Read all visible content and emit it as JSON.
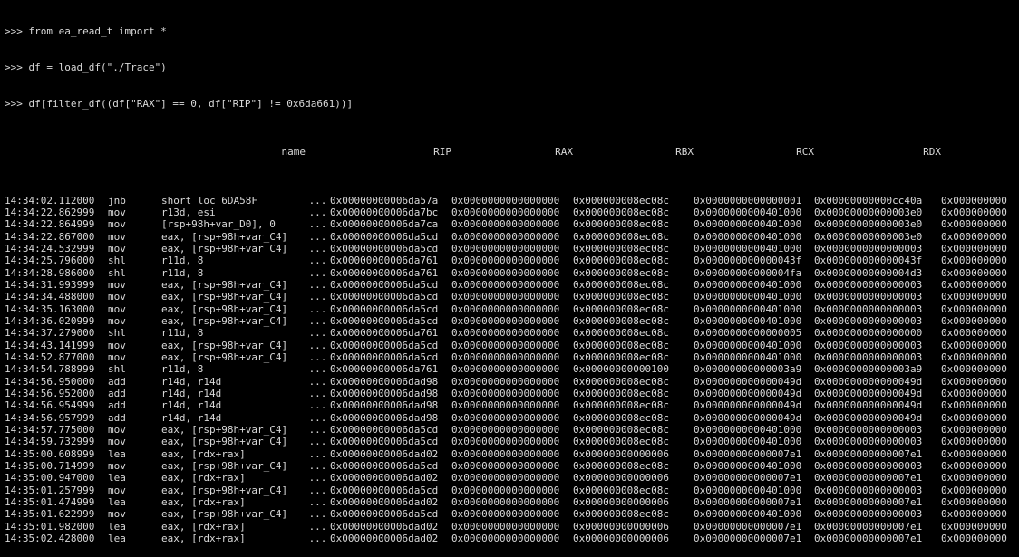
{
  "console": {
    "lines": [
      ">>> from ea_read_t import *",
      ">>> df = load_df(\"./Trace\")",
      ">>> df[filter_df((df[\"RAX\"] == 0, df[\"RIP\"] != 0x6da661))]"
    ]
  },
  "table": {
    "headers": {
      "name": "name",
      "rip": "RIP",
      "rax": "RAX",
      "rbx": "RBX",
      "rcx": "RCX",
      "rdx": "RDX"
    },
    "rows": [
      {
        "ts": "14:34:02.112000",
        "mn": "jnb",
        "op": "short loc_6DA58F",
        "el": "...",
        "rip": "0x00000000006da57a",
        "rax": "0x0000000000000000",
        "rbx": "0x000000008ec08c",
        "rcx": "0x0000000000000001",
        "rdx": "0x00000000000cc40a",
        "rest": "0x000000000"
      },
      {
        "ts": "14:34:22.862999",
        "mn": "mov",
        "op": "r13d, esi",
        "el": "...",
        "rip": "0x00000000006da7bc",
        "rax": "0x0000000000000000",
        "rbx": "0x000000008ec08c",
        "rcx": "0x0000000000401000",
        "rdx": "0x00000000000003e0",
        "rest": "0x000000000"
      },
      {
        "ts": "14:34:22.864999",
        "mn": "mov",
        "op": "[rsp+98h+var_D0], 0",
        "el": "...",
        "rip": "0x00000000006da7ca",
        "rax": "0x0000000000000000",
        "rbx": "0x000000008ec08c",
        "rcx": "0x0000000000401000",
        "rdx": "0x00000000000003e0",
        "rest": "0x000000000"
      },
      {
        "ts": "14:34:22.867000",
        "mn": "mov",
        "op": "eax, [rsp+98h+var_C4]",
        "el": "...",
        "rip": "0x00000000006da5cd",
        "rax": "0x0000000000000000",
        "rbx": "0x000000008ec08c",
        "rcx": "0x0000000000401000",
        "rdx": "0x00000000000003e0",
        "rest": "0x000000000"
      },
      {
        "ts": "14:34:24.532999",
        "mn": "mov",
        "op": "eax, [rsp+98h+var_C4]",
        "el": "...",
        "rip": "0x00000000006da5cd",
        "rax": "0x0000000000000000",
        "rbx": "0x000000008ec08c",
        "rcx": "0x0000000000401000",
        "rdx": "0x0000000000000003",
        "rest": "0x000000000"
      },
      {
        "ts": "14:34:25.796000",
        "mn": "shl",
        "op": "r11d, 8",
        "el": "...",
        "rip": "0x00000000006da761",
        "rbx": "0x000000008ec08c",
        "rax": "0x0000000000000000",
        "rcx": "0x000000000000043f",
        "rdx": "0x000000000000043f",
        "rest": "0x000000000"
      },
      {
        "ts": "14:34:28.986000",
        "mn": "shl",
        "op": "r11d, 8",
        "el": "...",
        "rip": "0x00000000006da761",
        "rax": "0x0000000000000000",
        "rbx": "0x000000008ec08c",
        "rcx": "0x00000000000004fa",
        "rdx": "0x00000000000004d3",
        "rest": "0x000000000"
      },
      {
        "ts": "14:34:31.993999",
        "mn": "mov",
        "op": "eax, [rsp+98h+var_C4]",
        "el": "...",
        "rip": "0x00000000006da5cd",
        "rax": "0x0000000000000000",
        "rbx": "0x000000008ec08c",
        "rcx": "0x0000000000401000",
        "rdx": "0x0000000000000003",
        "rest": "0x000000000"
      },
      {
        "ts": "14:34:34.488000",
        "mn": "mov",
        "op": "eax, [rsp+98h+var_C4]",
        "el": "...",
        "rip": "0x00000000006da5cd",
        "rax": "0x0000000000000000",
        "rbx": "0x000000008ec08c",
        "rcx": "0x0000000000401000",
        "rdx": "0x0000000000000003",
        "rest": "0x000000000"
      },
      {
        "ts": "14:34:35.163000",
        "mn": "mov",
        "op": "eax, [rsp+98h+var_C4]",
        "el": "...",
        "rip": "0x00000000006da5cd",
        "rax": "0x0000000000000000",
        "rbx": "0x000000008ec08c",
        "rcx": "0x0000000000401000",
        "rdx": "0x0000000000000003",
        "rest": "0x000000000"
      },
      {
        "ts": "14:34:36.020999",
        "mn": "mov",
        "op": "eax, [rsp+98h+var_C4]",
        "el": "...",
        "rip": "0x00000000006da5cd",
        "rax": "0x0000000000000000",
        "rbx": "0x000000008ec08c",
        "rcx": "0x0000000000401000",
        "rdx": "0x0000000000000003",
        "rest": "0x000000000"
      },
      {
        "ts": "14:34:37.279000",
        "mn": "shl",
        "op": "r11d, 8",
        "el": "...",
        "rip": "0x00000000006da761",
        "rax": "0x0000000000000000",
        "rbx": "0x000000008ec08c",
        "rcx": "0x0000000000000005",
        "rdx": "0x0000000000000000",
        "rest": "0x000000000"
      },
      {
        "ts": "14:34:43.141999",
        "mn": "mov",
        "op": "eax, [rsp+98h+var_C4]",
        "el": "...",
        "rip": "0x00000000006da5cd",
        "rax": "0x0000000000000000",
        "rbx": "0x000000008ec08c",
        "rcx": "0x0000000000401000",
        "rdx": "0x0000000000000003",
        "rest": "0x000000000"
      },
      {
        "ts": "14:34:52.877000",
        "mn": "mov",
        "op": "eax, [rsp+98h+var_C4]",
        "el": "...",
        "rip": "0x00000000006da5cd",
        "rax": "0x0000000000000000",
        "rbx": "0x000000008ec08c",
        "rcx": "0x0000000000401000",
        "rdx": "0x0000000000000003",
        "rest": "0x000000000"
      },
      {
        "ts": "14:34:54.788999",
        "mn": "shl",
        "op": "r11d, 8",
        "el": "...",
        "rip": "0x00000000006da761",
        "rax": "0x0000000000000000",
        "rbx": "0x00000000000100",
        "rcx": "0x00000000000003a9",
        "rdx": "0x00000000000003a9",
        "rest": "0x000000000"
      },
      {
        "ts": "14:34:56.950000",
        "mn": "add",
        "op": "r14d, r14d",
        "el": "...",
        "rip": "0x00000000006dad98",
        "rax": "0x0000000000000000",
        "rbx": "0x000000008ec08c",
        "rcx": "0x000000000000049d",
        "rdx": "0x000000000000049d",
        "rest": "0x000000000"
      },
      {
        "ts": "14:34:56.952000",
        "mn": "add",
        "op": "r14d, r14d",
        "el": "...",
        "rip": "0x00000000006dad98",
        "rax": "0x0000000000000000",
        "rbx": "0x000000008ec08c",
        "rcx": "0x000000000000049d",
        "rdx": "0x000000000000049d",
        "rest": "0x000000000"
      },
      {
        "ts": "14:34:56.954999",
        "mn": "add",
        "op": "r14d, r14d",
        "el": "...",
        "rip": "0x00000000006dad98",
        "rax": "0x0000000000000000",
        "rbx": "0x000000008ec08c",
        "rcx": "0x000000000000049d",
        "rdx": "0x000000000000049d",
        "rest": "0x000000000"
      },
      {
        "ts": "14:34:56.957999",
        "mn": "add",
        "op": "r14d, r14d",
        "el": "...",
        "rip": "0x00000000006dad98",
        "rax": "0x0000000000000000",
        "rbx": "0x000000008ec08c",
        "rcx": "0x000000000000049d",
        "rdx": "0x000000000000049d",
        "rest": "0x000000000"
      },
      {
        "ts": "14:34:57.775000",
        "mn": "mov",
        "op": "eax, [rsp+98h+var_C4]",
        "el": "...",
        "rip": "0x00000000006da5cd",
        "rax": "0x0000000000000000",
        "rbx": "0x000000008ec08c",
        "rcx": "0x0000000000401000",
        "rdx": "0x0000000000000003",
        "rest": "0x000000000"
      },
      {
        "ts": "14:34:59.732999",
        "mn": "mov",
        "op": "eax, [rsp+98h+var_C4]",
        "el": "...",
        "rip": "0x00000000006da5cd",
        "rax": "0x0000000000000000",
        "rbx": "0x000000008ec08c",
        "rcx": "0x0000000000401000",
        "rdx": "0x0000000000000003",
        "rest": "0x000000000"
      },
      {
        "ts": "14:35:00.608999",
        "mn": "lea",
        "op": "eax, [rdx+rax]",
        "el": "...",
        "rip": "0x00000000006dad02",
        "rax": "0x0000000000000000",
        "rbx": "0x00000000000006",
        "rcx": "0x00000000000007e1",
        "rdx": "0x00000000000007e1",
        "rest": "0x000000000"
      },
      {
        "ts": "14:35:00.714999",
        "mn": "mov",
        "op": "eax, [rsp+98h+var_C4]",
        "el": "...",
        "rip": "0x00000000006da5cd",
        "rax": "0x0000000000000000",
        "rbx": "0x000000008ec08c",
        "rcx": "0x0000000000401000",
        "rdx": "0x0000000000000003",
        "rest": "0x000000000"
      },
      {
        "ts": "14:35:00.947000",
        "mn": "lea",
        "op": "eax, [rdx+rax]",
        "el": "...",
        "rip": "0x00000000006dad02",
        "rax": "0x0000000000000000",
        "rbx": "0x00000000000006",
        "rcx": "0x00000000000007e1",
        "rdx": "0x00000000000007e1",
        "rest": "0x000000000"
      },
      {
        "ts": "14:35:01.257999",
        "mn": "mov",
        "op": "eax, [rsp+98h+var_C4]",
        "el": "...",
        "rip": "0x00000000006da5cd",
        "rax": "0x0000000000000000",
        "rbx": "0x000000008ec08c",
        "rcx": "0x0000000000401000",
        "rdx": "0x0000000000000003",
        "rest": "0x000000000"
      },
      {
        "ts": "14:35:01.474999",
        "mn": "lea",
        "op": "eax, [rdx+rax]",
        "el": "...",
        "rip": "0x00000000006dad02",
        "rax": "0x0000000000000000",
        "rbx": "0x00000000000006",
        "rcx": "0x00000000000007e1",
        "rdx": "0x00000000000007e1",
        "rest": "0x000000000"
      },
      {
        "ts": "14:35:01.622999",
        "mn": "mov",
        "op": "eax, [rsp+98h+var_C4]",
        "el": "...",
        "rip": "0x00000000006da5cd",
        "rax": "0x0000000000000000",
        "rbx": "0x000000008ec08c",
        "rcx": "0x0000000000401000",
        "rdx": "0x0000000000000003",
        "rest": "0x000000000"
      },
      {
        "ts": "14:35:01.982000",
        "mn": "lea",
        "op": "eax, [rdx+rax]",
        "el": "...",
        "rip": "0x00000000006dad02",
        "rax": "0x0000000000000000",
        "rbx": "0x00000000000006",
        "rcx": "0x00000000000007e1",
        "rdx": "0x00000000000007e1",
        "rest": "0x000000000"
      },
      {
        "ts": "14:35:02.428000",
        "mn": "lea",
        "op": "eax, [rdx+rax]",
        "el": "...",
        "rip": "0x00000000006dad02",
        "rax": "0x0000000000000000",
        "rbx": "0x00000000000006",
        "rcx": "0x00000000000007e1",
        "rdx": "0x00000000000007e1",
        "rest": "0x000000000"
      }
    ]
  }
}
